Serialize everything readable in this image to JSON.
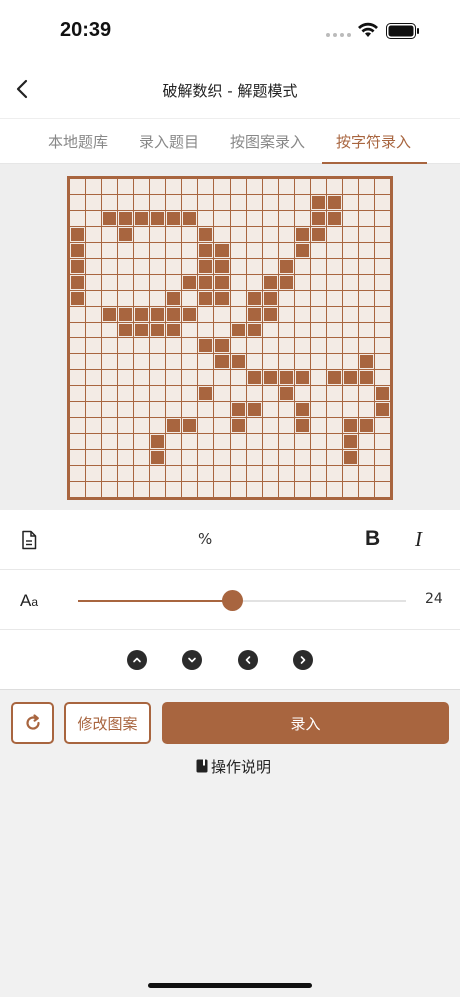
{
  "status": {
    "time": "20:39"
  },
  "nav": {
    "title": "破解数织 - 解题模式"
  },
  "tabs": [
    {
      "label": "本地题库",
      "active": false
    },
    {
      "label": "录入题目",
      "active": false
    },
    {
      "label": "按图案录入",
      "active": false
    },
    {
      "label": "按字符录入",
      "active": true
    }
  ],
  "grid": {
    "size": 20,
    "rows": [
      "....................",
      "...............##...",
      "..######.......##...",
      "#..#....#.....##....",
      "#.......##....#.....",
      "#.......##...#......",
      "#......###..##......",
      "#.....#.##.##.......",
      "..######...##.......",
      "...####...##........",
      "........##.........",
      ".........##.......#...",
      "...........####.###",
      "........#....#.....#",
      "..........##..#....##",
      "......##..#...#..##.",
      ".....#...........#..",
      ".....#...........#..",
      "....................",
      "...................."
    ]
  },
  "toolbar": {
    "percent_label": "%",
    "bold_label": "B",
    "italic_label": "I",
    "font_size_value": "24",
    "font_size_fraction": 0.47
  },
  "actions": {
    "edit_label": "修改图案",
    "submit_label": "录入",
    "help_label": "操作说明"
  },
  "colors": {
    "accent": "#a8653f"
  }
}
